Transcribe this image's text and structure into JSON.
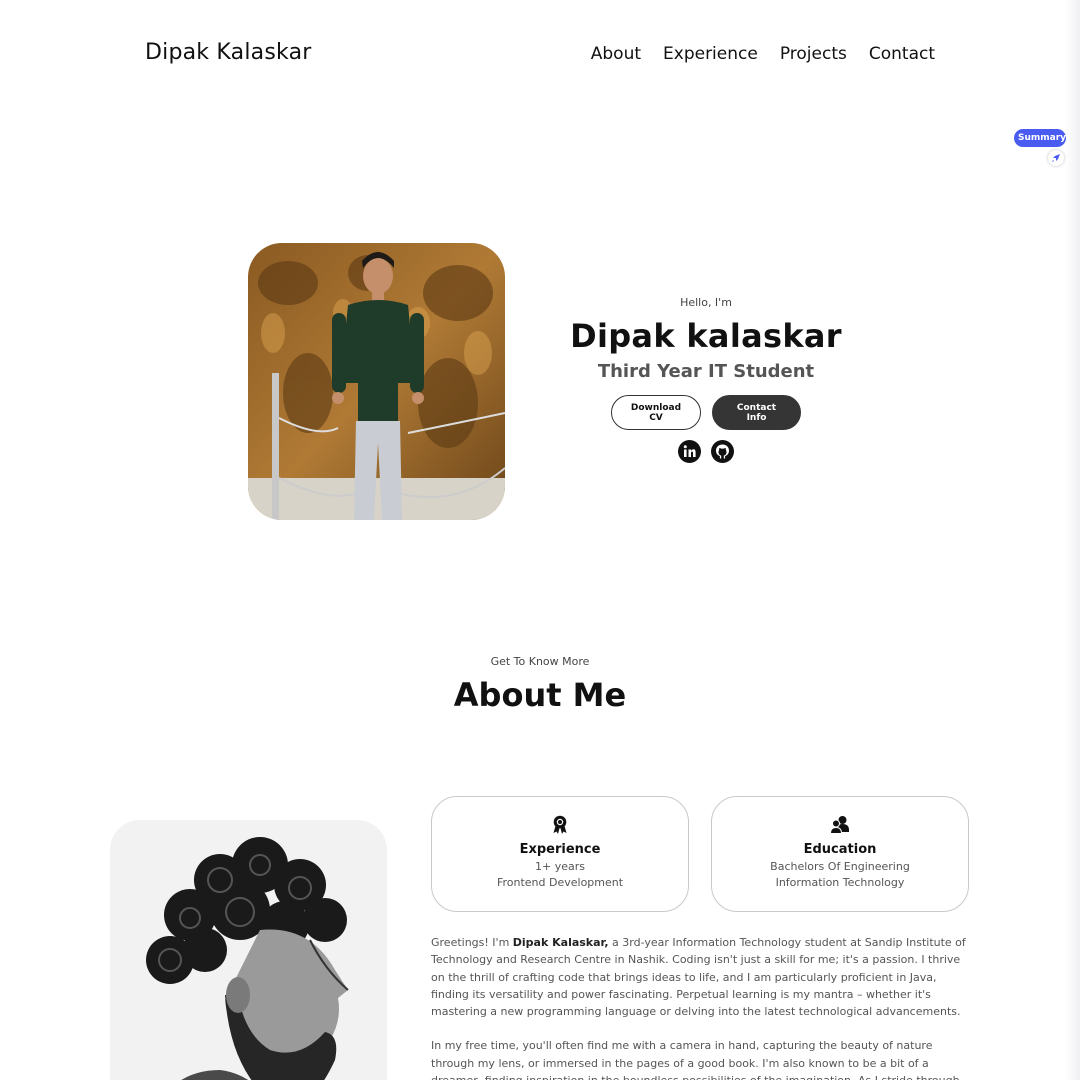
{
  "nav": {
    "logo": "Dipak Kalaskar",
    "links": [
      "About",
      "Experience",
      "Projects",
      "Contact"
    ]
  },
  "widget": {
    "summary_label": "Summary",
    "icon": "rocket-icon"
  },
  "hero": {
    "greeting": "Hello, I'm",
    "name": "Dipak kalaskar",
    "role": "Third Year IT Student",
    "download_cv": "Download CV",
    "contact_info": "Contact Info",
    "social_icons": [
      "linkedin-icon",
      "github-icon"
    ]
  },
  "about": {
    "subtitle": "Get To Know More",
    "title": "About Me",
    "cards": [
      {
        "icon": "award-icon",
        "title": "Experience",
        "lines": [
          "1+ years",
          "Frontend Development"
        ]
      },
      {
        "icon": "users-icon",
        "title": "Education",
        "lines": [
          "Bachelors Of Engineering",
          "Information Technology"
        ]
      }
    ],
    "para1_prefix": "Greetings! I'm ",
    "para1_name": "Dipak Kalaskar,",
    "para1_rest": " a 3rd-year Information Technology student at Sandip Institute of Technology and Research Centre in Nashik. Coding isn't just a skill for me; it's a passion. I thrive on the thrill of crafting code that brings ideas to life, and I am particularly proficient in Java, finding its versatility and power fascinating. Perpetual learning is my mantra – whether it's mastering a new programming language or delving into the latest technological advancements.",
    "para2": "In my free time, you'll often find me with a camera in hand, capturing the beauty of nature through my lens, or immersed in the pages of a good book. I'm also known to be a bit of a dreamer, finding inspiration in the boundless possibilities of the imagination. As I stride through"
  },
  "colors": {
    "accent": "#4a5bf2",
    "dark_button": "#353535"
  }
}
